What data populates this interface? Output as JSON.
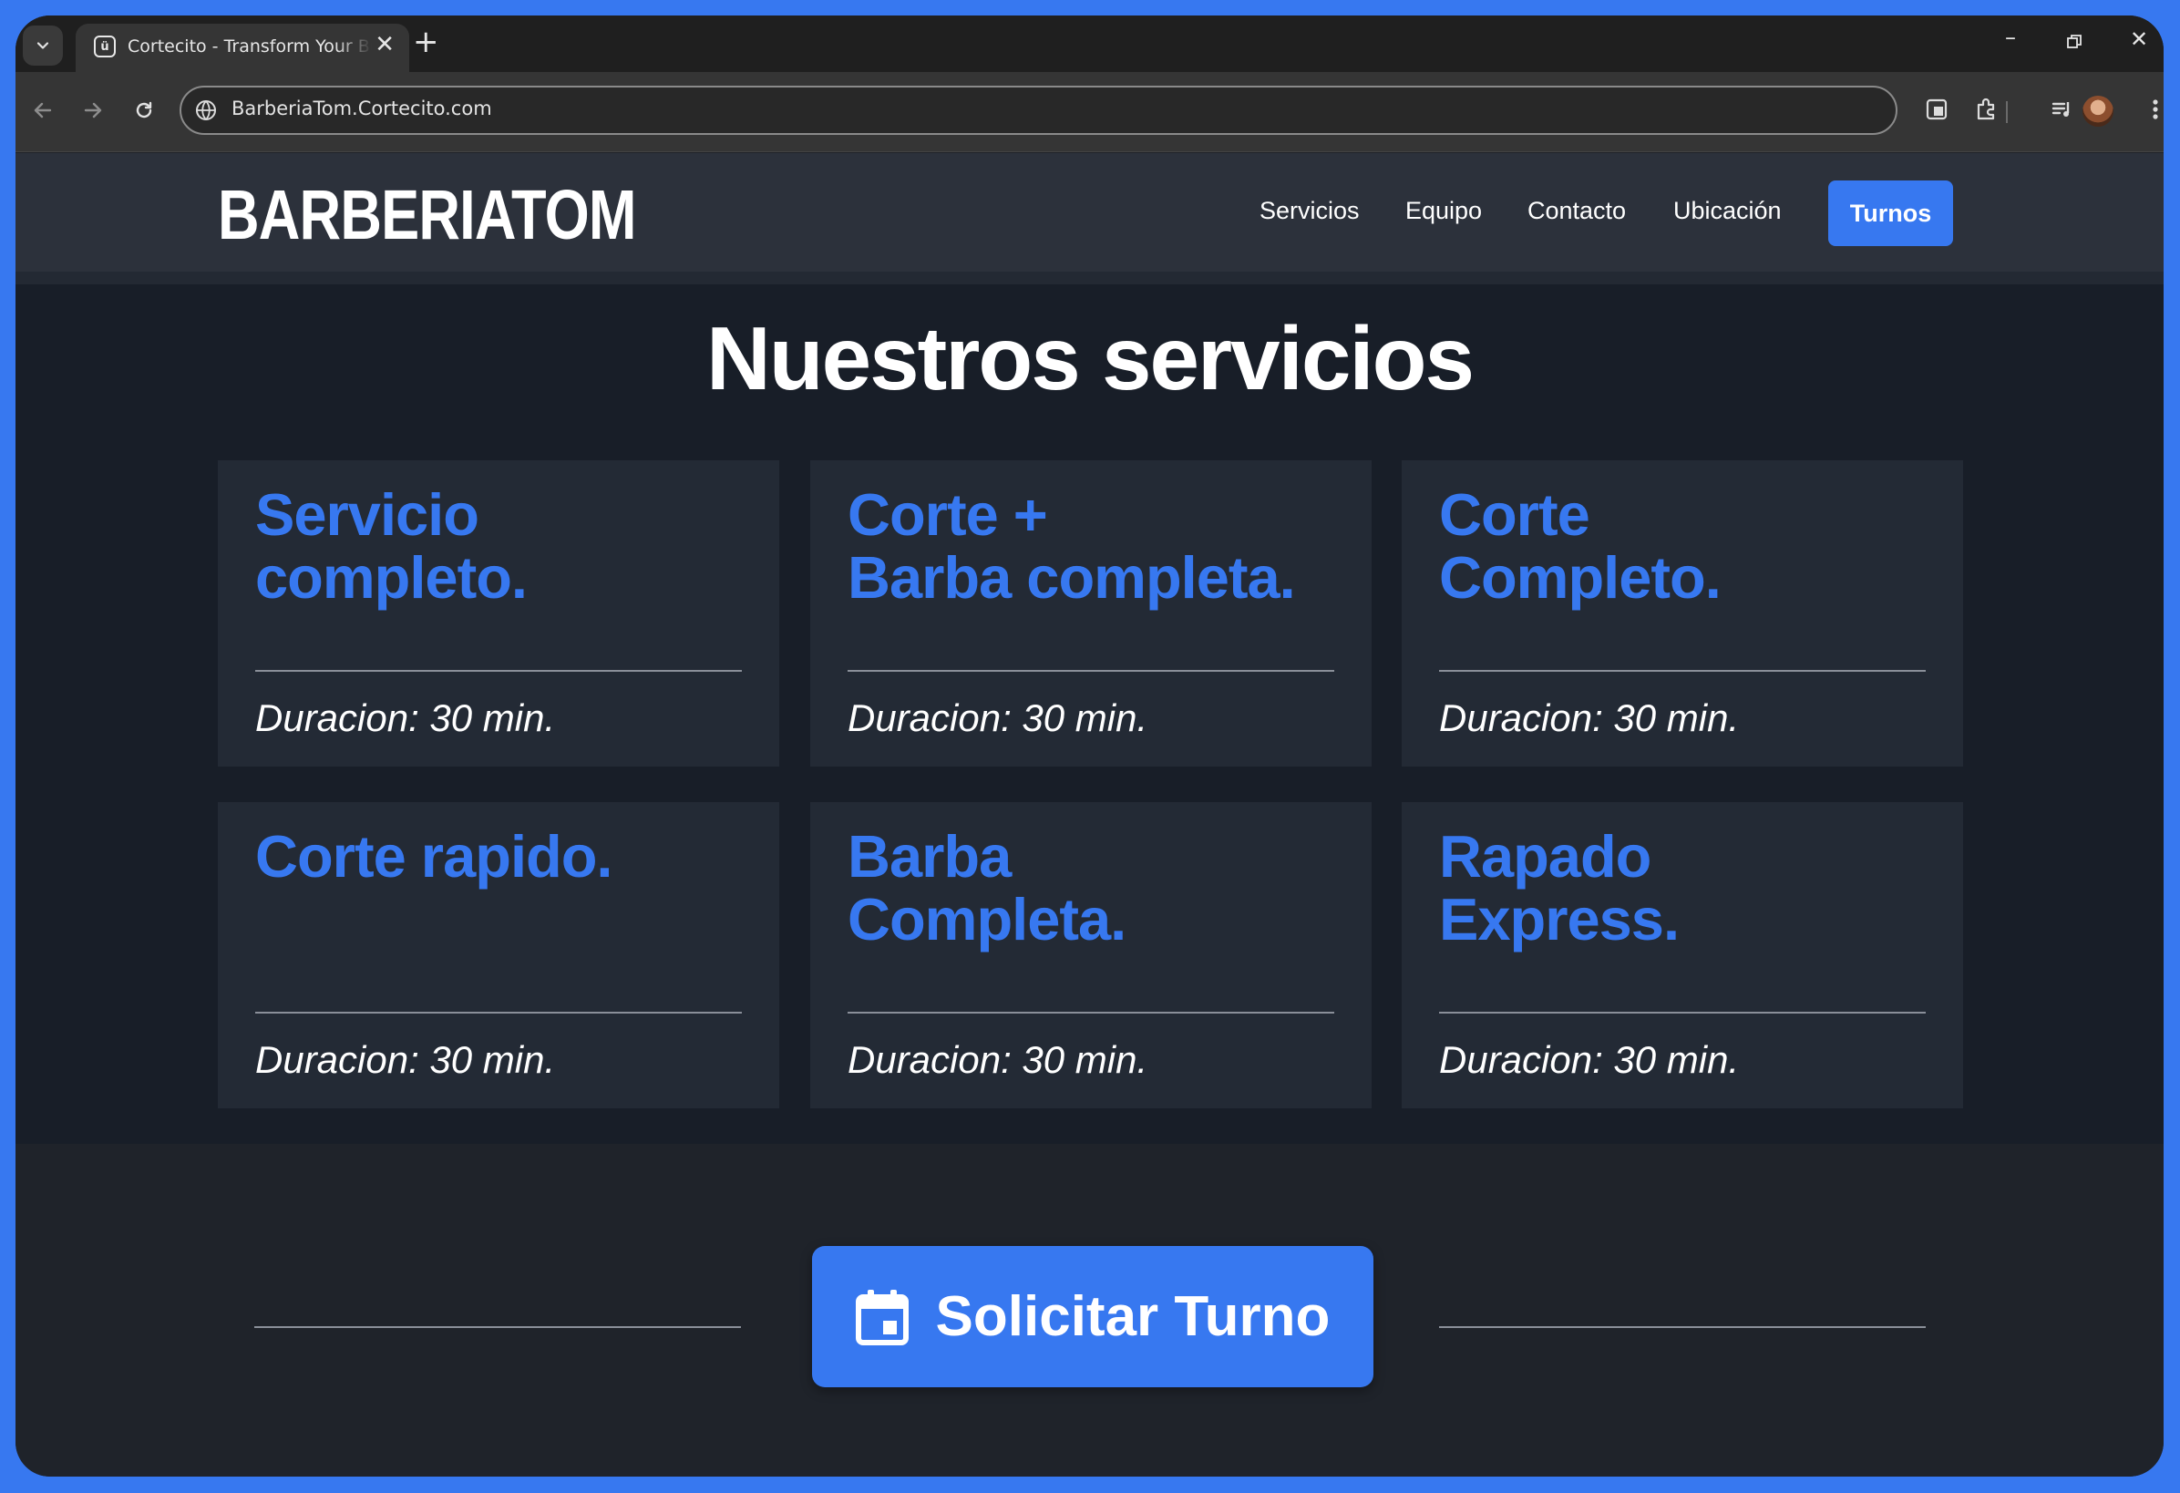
{
  "browser": {
    "tab_title": "Cortecito - Transform Your Business",
    "url": "BarberiaTom.Cortecito.com"
  },
  "site": {
    "logo": "BARBERIATOM",
    "nav": {
      "servicios": "Servicios",
      "equipo": "Equipo",
      "contacto": "Contacto",
      "ubicacion": "Ubicación",
      "cta": "Turnos"
    }
  },
  "services": {
    "title": "Nuestros servicios",
    "items": [
      {
        "name_line1": "Servicio",
        "name_line2": "completo.",
        "duration": "Duracion: 30 min."
      },
      {
        "name_line1": "Corte +",
        "name_line2": "Barba completa.",
        "duration": "Duracion: 30 min."
      },
      {
        "name_line1": "Corte",
        "name_line2": "Completo.",
        "duration": "Duracion: 30 min."
      },
      {
        "name_line1": "Corte rapido.",
        "name_line2": "",
        "duration": "Duracion: 30 min."
      },
      {
        "name_line1": "Barba",
        "name_line2": "Completa.",
        "duration": "Duracion: 30 min."
      },
      {
        "name_line1": "Rapado",
        "name_line2": "Express.",
        "duration": "Duracion: 30 min."
      }
    ]
  },
  "cta": {
    "label": "Solicitar Turno",
    "icon": "calendar-icon"
  },
  "colors": {
    "accent": "#3778f0",
    "page_bg": "#181e28",
    "card_bg": "#232a35",
    "header_bg": "#2c313b"
  }
}
